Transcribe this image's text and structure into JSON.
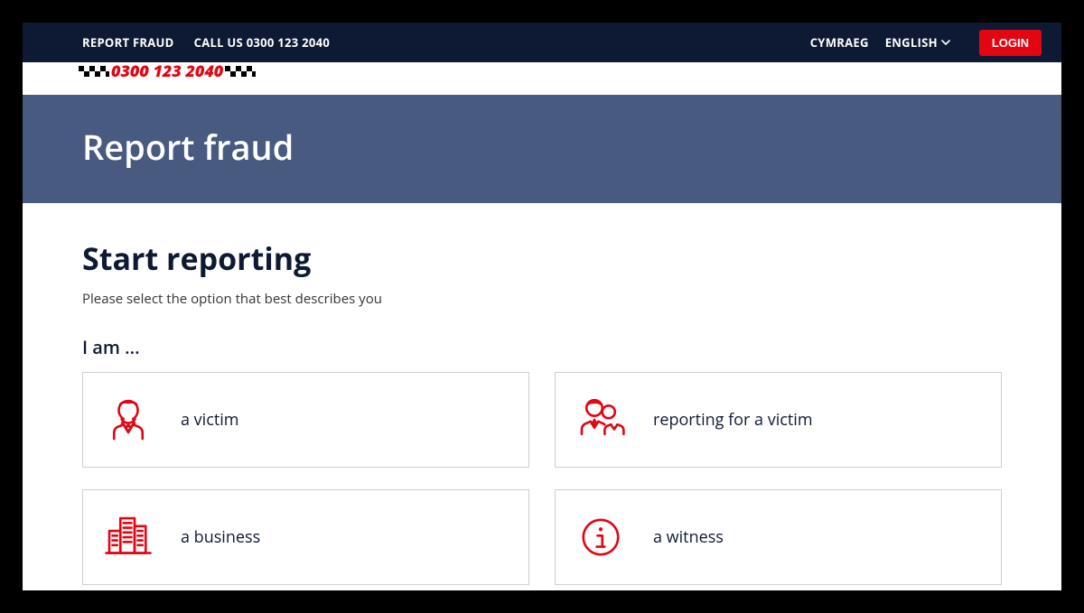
{
  "topbar": {
    "report_link": "REPORT FRAUD",
    "call_link": "CALL US 0300 123 2040",
    "lang_cy": "CYMRAEG",
    "lang_en": "ENGLISH",
    "login": "LOGIN"
  },
  "brand": {
    "phone": "0300 123 2040"
  },
  "hero": {
    "title": "Report fraud"
  },
  "main": {
    "heading": "Start reporting",
    "subtitle": "Please select the option that best describes you",
    "iam": "I am ..."
  },
  "cards": {
    "victim": "a victim",
    "reporting_for_victim": "reporting for a victim",
    "business": "a business",
    "witness": "a witness"
  }
}
